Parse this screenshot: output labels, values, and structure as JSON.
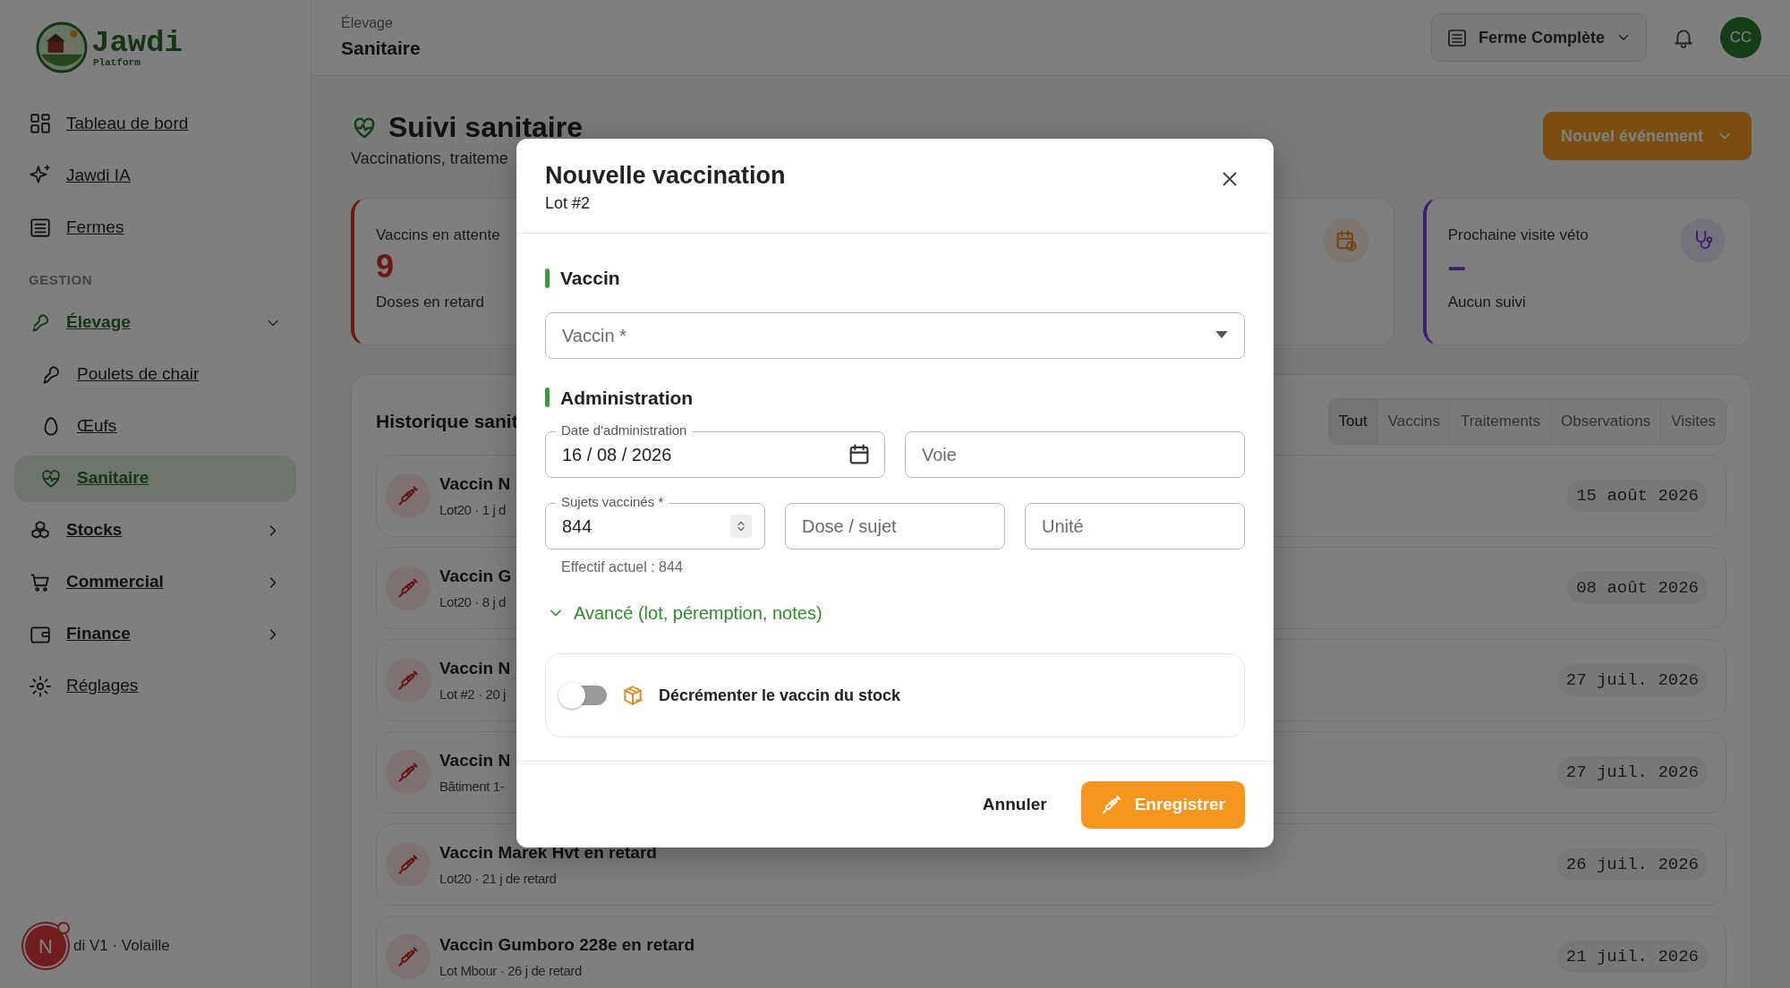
{
  "sidebar": {
    "logo": {
      "title": "Jawdi",
      "subtitle": "Platform"
    },
    "items": [
      {
        "kind": "link",
        "label": "Tableau de bord",
        "selected": false
      },
      {
        "kind": "link",
        "label": "Jawdi IA",
        "selected": false
      },
      {
        "kind": "link",
        "label": "Fermes",
        "selected": false
      },
      {
        "kind": "section",
        "label": "GESTION"
      },
      {
        "kind": "group",
        "label": "Élevage",
        "selected": false,
        "expanded": true,
        "children": [
          {
            "label": "Poulets de chair",
            "selected": false
          },
          {
            "label": "Œufs",
            "selected": false
          },
          {
            "label": "Sanitaire",
            "selected": true
          }
        ]
      },
      {
        "kind": "group",
        "label": "Stocks",
        "selected": false,
        "expanded": false
      },
      {
        "kind": "group",
        "label": "Commercial",
        "selected": false,
        "expanded": false
      },
      {
        "kind": "group",
        "label": "Finance",
        "selected": false,
        "expanded": false
      },
      {
        "kind": "link",
        "label": "Réglages",
        "selected": false
      }
    ],
    "footer": {
      "badge": "N",
      "text": "di V1 · Volaille"
    }
  },
  "topbar": {
    "breadcrumb": "Élevage",
    "title": "Sanitaire",
    "farm_selector": "Ferme Complète",
    "avatar": "CC"
  },
  "page": {
    "title": "Suivi sanitaire",
    "subtitle": "Vaccinations, traiteme",
    "primary_button": "Nouvel événement"
  },
  "stats": [
    {
      "label": "Vaccins en attente",
      "value": "9",
      "note": "Doses en retard"
    },
    {
      "kind": "icon_only"
    },
    {
      "label": "Prochaine visite véto",
      "value": "–",
      "note": "Aucun suivi"
    }
  ],
  "history": {
    "title": "Historique sanit",
    "tabs": [
      {
        "label": "Tout",
        "selected": true
      },
      {
        "label": "Vaccins",
        "selected": false
      },
      {
        "label": "Traitements",
        "selected": false
      },
      {
        "label": "Observations",
        "selected": false
      },
      {
        "label": "Visites",
        "selected": false
      }
    ],
    "rows": [
      {
        "title": "Vaccin N",
        "subtitle": "Lot20 · 1 j d",
        "date": "15 août 2026"
      },
      {
        "title": "Vaccin G",
        "subtitle": "Lot20 · 8 j d",
        "date": "08 août 2026"
      },
      {
        "title": "Vaccin N",
        "subtitle": "Lot #2 · 20 j",
        "date": "27 juil. 2026"
      },
      {
        "title": "Vaccin N",
        "subtitle": "Bâtiment 1-",
        "date": "27 juil. 2026"
      },
      {
        "title": "Vaccin Marek Hvt en retard",
        "subtitle": "Lot20 · 21 j de retard",
        "date": "26 juil. 2026"
      },
      {
        "title": "Vaccin Gumboro 228e en retard",
        "subtitle": "Lot Mbour · 26 j de retard",
        "date": "21 juil. 2026"
      }
    ]
  },
  "modal": {
    "title": "Nouvelle vaccination",
    "subtitle": "Lot #2",
    "sections": [
      {
        "heading": "Vaccin",
        "rows": [
          [
            {
              "kind": "select",
              "placeholder": "Vaccin *"
            }
          ]
        ]
      },
      {
        "heading": "Administration",
        "rows": [
          [
            {
              "kind": "date",
              "label": "Date d'administration",
              "value": "16 / 08 / 2026"
            },
            {
              "kind": "text",
              "placeholder": "Voie"
            }
          ],
          [
            {
              "kind": "number",
              "label": "Sujets vaccinés *",
              "value": "844",
              "hint": "Effectif actuel : 844"
            },
            {
              "kind": "text",
              "placeholder": "Dose / sujet"
            },
            {
              "kind": "text",
              "placeholder": "Unité"
            }
          ]
        ]
      }
    ],
    "advanced": {
      "label": "Avancé (lot, péremption, notes)",
      "expanded": false
    },
    "stock_toggle": {
      "label": "Décrémenter le vaccin du stock",
      "on": false
    },
    "buttons": [
      {
        "kind": "cancel",
        "label": "Annuler"
      },
      {
        "kind": "primary",
        "label": "Enregistrer"
      }
    ]
  }
}
